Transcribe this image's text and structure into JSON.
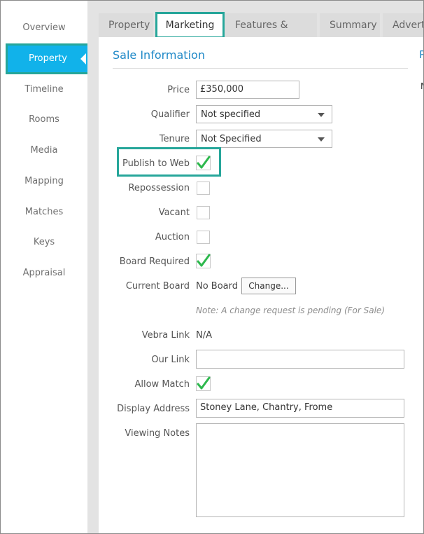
{
  "sidebar": {
    "items": [
      {
        "label": "Overview"
      },
      {
        "label": "Property"
      },
      {
        "label": "Timeline"
      },
      {
        "label": "Rooms"
      },
      {
        "label": "Media"
      },
      {
        "label": "Mapping"
      },
      {
        "label": "Matches"
      },
      {
        "label": "Keys"
      },
      {
        "label": "Appraisal"
      }
    ],
    "active": "Property"
  },
  "tabs": [
    {
      "label": "Property"
    },
    {
      "label": "Marketing"
    },
    {
      "label": "Features & Areas"
    },
    {
      "label": "Summary"
    },
    {
      "label": "Advert"
    }
  ],
  "active_tab": "Marketing",
  "section": {
    "title": "Sale Information",
    "right_fragment": "P",
    "right_fragment2": "N"
  },
  "form": {
    "price_label": "Price",
    "price_value": "£350,000",
    "qualifier_label": "Qualifier",
    "qualifier_value": "Not specified",
    "tenure_label": "Tenure",
    "tenure_value": "Not Specified",
    "publish_label": "Publish to Web",
    "publish_checked": true,
    "repossession_label": "Repossession",
    "repossession_checked": false,
    "vacant_label": "Vacant",
    "vacant_checked": false,
    "auction_label": "Auction",
    "auction_checked": false,
    "board_required_label": "Board Required",
    "board_required_checked": true,
    "current_board_label": "Current Board",
    "current_board_value": "No Board",
    "change_button": "Change...",
    "pending_note": "Note: A change request is pending (For Sale)",
    "vebra_link_label": "Vebra Link",
    "vebra_link_value": "N/A",
    "our_link_label": "Our Link",
    "our_link_value": "",
    "allow_match_label": "Allow Match",
    "allow_match_checked": true,
    "display_address_label": "Display Address",
    "display_address_value": "Stoney Lane, Chantry, Frome",
    "viewing_notes_label": "Viewing Notes",
    "viewing_notes_value": ""
  },
  "colors": {
    "accent_teal": "#26a69a",
    "active_blue": "#11b2ea",
    "title_blue": "#1e88c7",
    "check_green": "#2db84d"
  },
  "icons": [
    "active-arrow-notch-icon",
    "chevron-down-icon",
    "checkmark-icon"
  ]
}
